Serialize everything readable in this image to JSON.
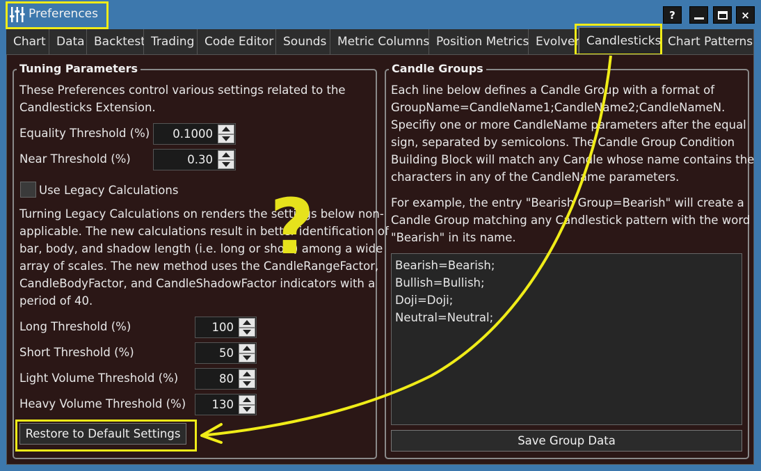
{
  "window": {
    "title": "Preferences",
    "help_label": "?",
    "close_label": "×"
  },
  "tabs": [
    {
      "label": "Chart"
    },
    {
      "label": "Data"
    },
    {
      "label": "Backtest"
    },
    {
      "label": "Trading"
    },
    {
      "label": "Code Editor"
    },
    {
      "label": "Sounds"
    },
    {
      "label": "Metric Columns"
    },
    {
      "label": "Position Metrics"
    },
    {
      "label": "Evolver"
    },
    {
      "label": "Candlesticks",
      "active": true
    },
    {
      "label": "Chart Patterns"
    }
  ],
  "tuning": {
    "title": "Tuning Parameters",
    "intro_lines": [
      "These Preferences control various settings related to the",
      "Candlesticks Extension."
    ],
    "equality_label": "Equality Threshold (%)",
    "equality_value": "0.1000",
    "near_label": "Near Threshold (%)",
    "near_value": "0.30",
    "legacy_label": "Use Legacy Calculations",
    "legacy_checked": false,
    "legacy_desc_lines": [
      "Turning Legacy Calculations on renders the settings below non-",
      "applicable. The new calculations result in better identification of",
      "bar, body, and shadow length (i.e. long or short) among a wide",
      "array of scales. The new method uses the CandleRangeFactor,",
      "CandleBodyFactor, and CandleShadowFactor indicators with a",
      "period of 40."
    ],
    "long_label": "Long Threshold (%)",
    "long_value": "100",
    "short_label": "Short Threshold (%)",
    "short_value": "50",
    "light_label": "Light Volume Threshold (%)",
    "light_value": "80",
    "heavy_label": "Heavy Volume Threshold (%)",
    "heavy_value": "130",
    "restore_label": "Restore to Default Settings"
  },
  "groups": {
    "title": "Candle Groups",
    "desc_lines": [
      "Each line below defines a Candle Group with a format of",
      "GroupName=CandleName1;CandleName2;CandleNameN.",
      "Specifiy one or more CandleName parameters after the equal",
      "sign, separated by semicolons. The Candle Group Condition",
      "Building Block will match any Candle whose name contains the",
      "characters in any of the CandleName parameters."
    ],
    "example_lines": [
      "For example, the entry \"Bearish Group=Bearish\" will create a",
      "Candle Group matching any Candlestick pattern with the word",
      "\"Bearish\" in its name."
    ],
    "entries": [
      "Bearish=Bearish;",
      "Bullish=Bullish;",
      "Doji=Doji;",
      "Neutral=Neutral;"
    ],
    "save_label": "Save Group Data"
  },
  "annotation": {
    "question_mark": "?",
    "color": "#f0ec18"
  }
}
